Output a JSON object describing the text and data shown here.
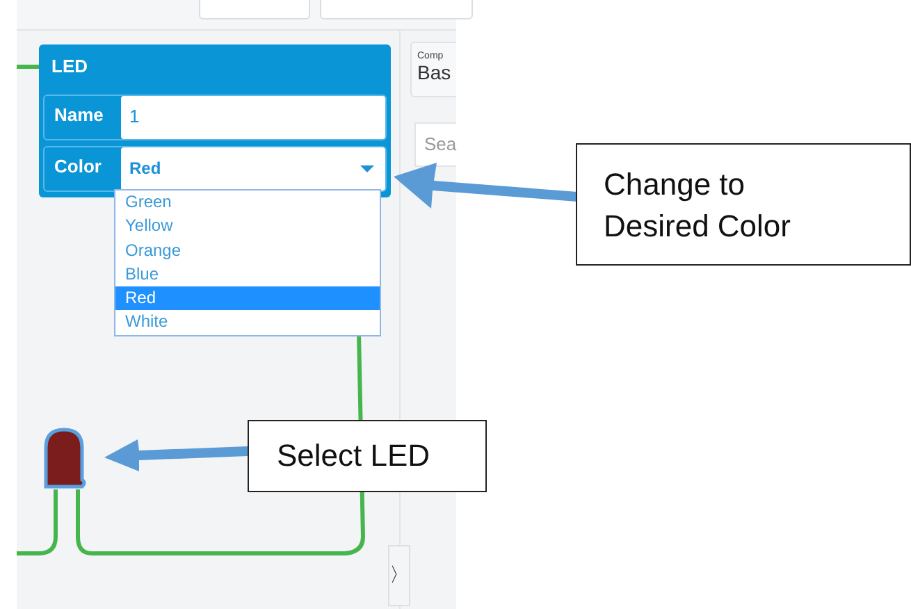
{
  "inspector": {
    "title": "LED",
    "fields": [
      {
        "label": "Name",
        "value": "1",
        "kind": "text"
      },
      {
        "label": "Color",
        "value": "Red",
        "kind": "select",
        "expanded": true
      }
    ],
    "options": [
      {
        "label": "Green",
        "selected": false
      },
      {
        "label": "Yellow",
        "selected": false
      },
      {
        "label": "Orange",
        "selected": false
      },
      {
        "label": "Blue",
        "selected": false
      },
      {
        "label": "Red",
        "selected": true
      },
      {
        "label": "White",
        "selected": false
      }
    ]
  },
  "side_panel": {
    "label": "Comp",
    "value": "Bas",
    "search_placeholder": "Sea",
    "collapse_button": "〉"
  },
  "led": {
    "color": "#7b1d1d",
    "selected": true
  },
  "callouts": [
    {
      "lines": [
        "Change to",
        "Desired Color"
      ]
    },
    {
      "lines": [
        "Select LED"
      ]
    }
  ]
}
